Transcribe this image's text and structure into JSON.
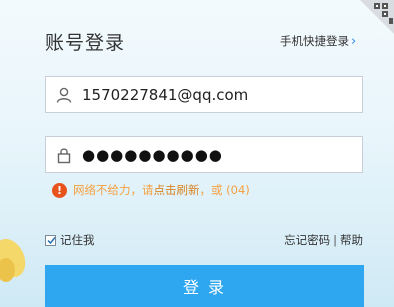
{
  "header": {
    "title": "账号登录",
    "switch_link": "手机快捷登录",
    "chevron_glyph": "›"
  },
  "account": {
    "value": "1570227841@qq.com"
  },
  "password": {
    "masked_value": "●●●●●●●●●●"
  },
  "error": {
    "icon_glyph": "!",
    "message": "网络不给力，请",
    "link": "点击刷新",
    "suffix": "，或 (04)"
  },
  "options": {
    "remember_label": "记住我",
    "forgot_label": "忘记密码",
    "separator": "|",
    "help_label": "帮助"
  },
  "login_button": {
    "label": "登 录"
  },
  "colors": {
    "accent": "#2ea7f0",
    "error_icon": "#e8521d",
    "error_text": "#f5a040"
  }
}
